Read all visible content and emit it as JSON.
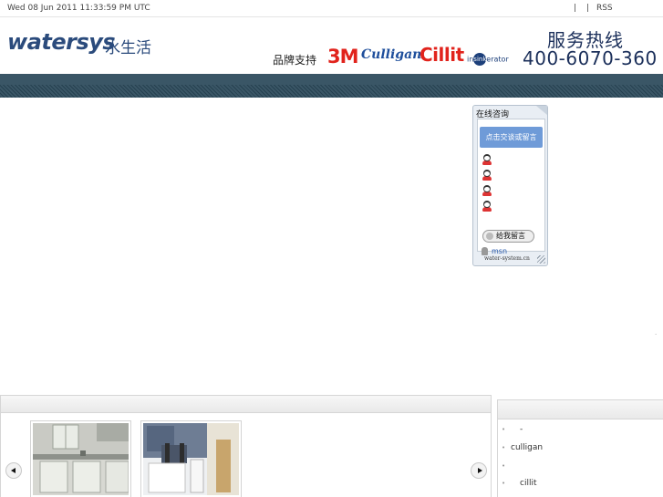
{
  "topbar": {
    "date": "Wed 08 Jun 2011 11:33:59 PM UTC",
    "separator1": "|",
    "separator2": "|",
    "rss": "RSS"
  },
  "header": {
    "logo": "watersys",
    "logo_cn": "水生活",
    "brand_label": "品牌支持",
    "brands": {
      "three_m": "3M",
      "culligan": "Culligan",
      "cillit": "Cillit",
      "insink_prefix": "in",
      "insink_dot": "sink",
      "insink_suffix": "erator"
    },
    "hotline_label": "服务热线",
    "hotline_number": "400-6070-360"
  },
  "chat_widget": {
    "title": "在线咨询",
    "consult_button": "点击交谈或留言",
    "qq_icon": "qq-penguin-icon",
    "message_button": "给我留言",
    "msn_label": "msn",
    "footer": "water-system.cn"
  },
  "gallery": {
    "prev_icon": "arrow-left-icon",
    "next_icon": "arrow-right-icon",
    "photos": [
      "kitchen-sink-photo",
      "water-equipment-photo"
    ]
  },
  "link_list": {
    "items": [
      {
        "label": "-"
      },
      {
        "label": "culligan"
      },
      {
        "label": ""
      },
      {
        "label": "cillit"
      }
    ]
  },
  "misc": {
    "stray_dot": "·"
  },
  "colors": {
    "brand_blue": "#2b4b7c",
    "nav_band": "#2e4b5c",
    "accent_red": "#e1231c",
    "chat_button": "#6f9bd8"
  }
}
